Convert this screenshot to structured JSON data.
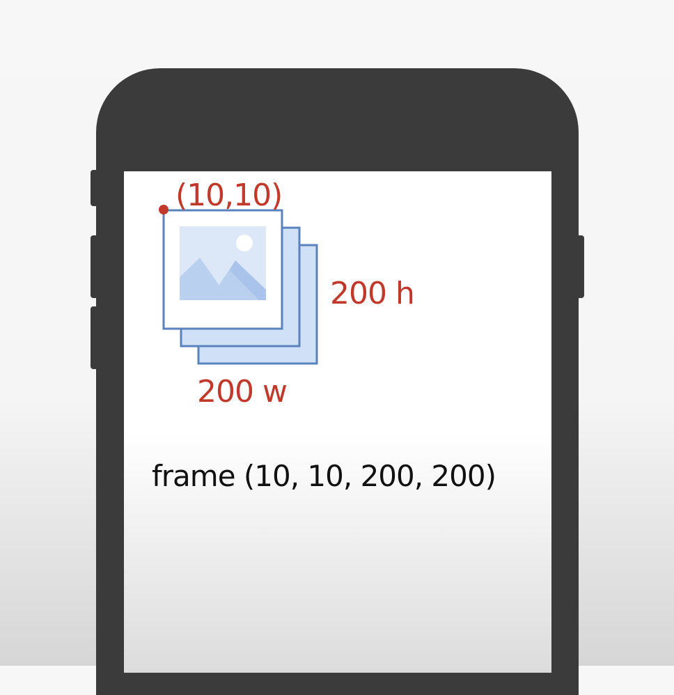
{
  "labels": {
    "origin": "(10,10)",
    "height": "200 h",
    "width": "200 w",
    "frame": "frame (10, 10, 200, 200)"
  },
  "icons": {
    "device": "phone-icon",
    "image": "image-placeholder-icon",
    "origin_marker": "origin-dot-icon"
  },
  "colors": {
    "accent_red": "#c0392b",
    "frame_blue": "#5a82bd",
    "fill_blue": "#cfe0f7",
    "device": "#3b3b3b",
    "text": "#111111"
  }
}
